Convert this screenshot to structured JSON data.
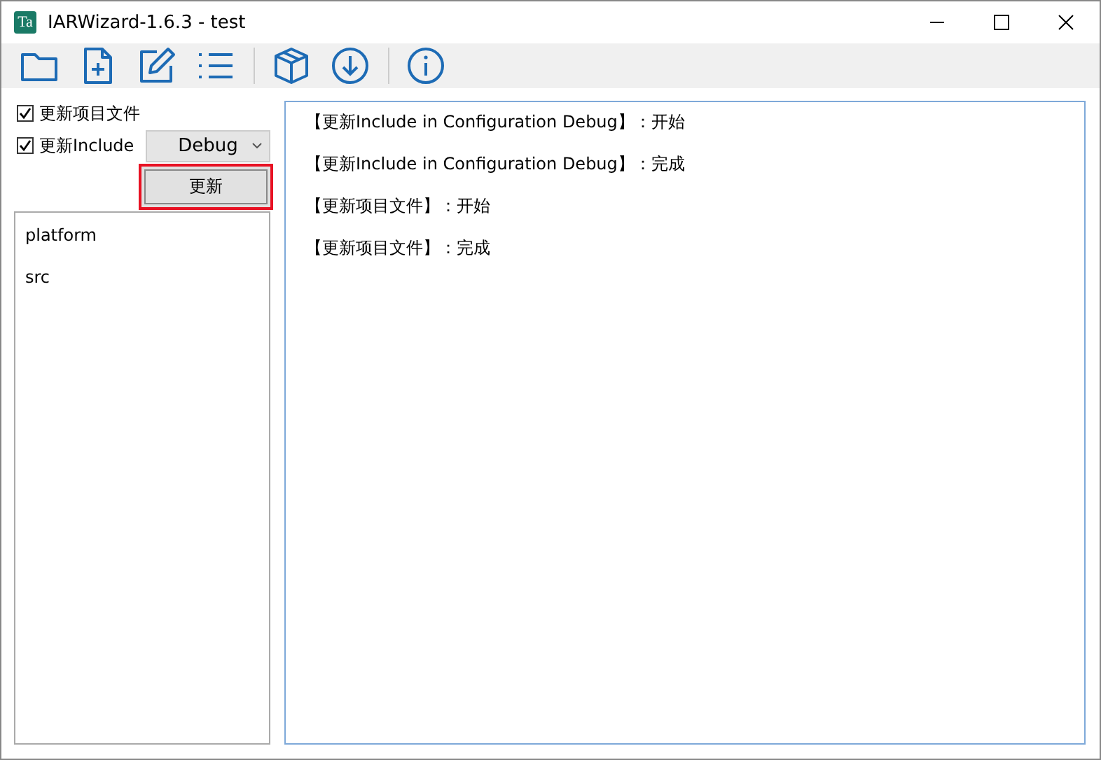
{
  "window": {
    "title": "IARWizard-1.6.3 - test",
    "app_icon_text": "Ta"
  },
  "toolbar": {
    "groups": [
      [
        {
          "kind": "folder"
        },
        {
          "kind": "file-plus"
        },
        {
          "kind": "edit"
        },
        {
          "kind": "list"
        }
      ],
      [
        {
          "kind": "package"
        },
        {
          "kind": "download"
        }
      ],
      [
        {
          "kind": "info"
        }
      ]
    ]
  },
  "options": [
    {
      "label": "更新项目文件",
      "checked": true
    },
    {
      "label": "更新Include",
      "checked": true
    }
  ],
  "config_dropdown": {
    "value": "Debug"
  },
  "update_button": {
    "label": "更新",
    "focused": true
  },
  "folders": [
    "platform",
    "src"
  ],
  "log": [
    "【更新Include in Configuration Debug】：开始",
    "【更新Include in Configuration Debug】：完成",
    "【更新项目文件】：开始",
    "【更新项目文件】：完成"
  ]
}
